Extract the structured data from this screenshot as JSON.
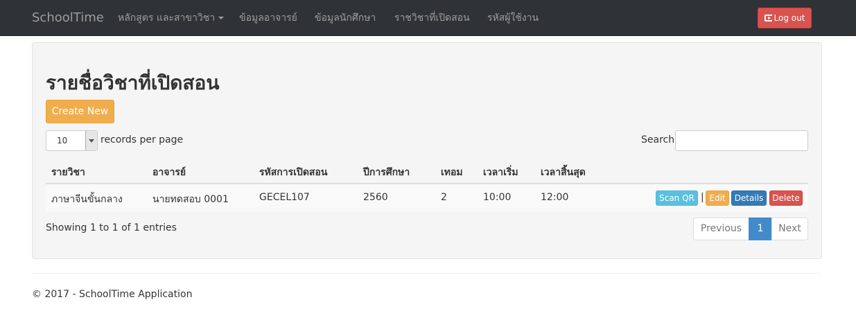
{
  "navbar": {
    "brand": "SchoolTime",
    "items": [
      {
        "label": "หลักสูตร และสาขาวิชา"
      },
      {
        "label": "ข้อมูลอาจารย์"
      },
      {
        "label": "ข้อมูลนักศึกษา"
      },
      {
        "label": "ราชวิชาที่เปิดสอน"
      },
      {
        "label": "รหัสผู้ใช้งาน"
      }
    ],
    "logout_label": "Log out"
  },
  "main": {
    "title": "รายชื่อวิชาที่เปิดสอน",
    "create_label": "Create New",
    "length": {
      "value": "10",
      "label": "records per page"
    },
    "search": {
      "label": "Search:",
      "value": ""
    },
    "table": {
      "headers": [
        "รายวิชา",
        "อาจารย์",
        "รหัสการเปิดสอน",
        "ปีการศึกษา",
        "เทอม",
        "เวลาเริ่ม",
        "เวลาสิ้นสุด"
      ],
      "rows": [
        {
          "cells": [
            "ภาษาจีนขั้นกลาง",
            "นายทดสอบ 0001",
            "GECEL107",
            "2560",
            "2",
            "10:00",
            "12:00"
          ],
          "actions": {
            "scan": "Scan QR",
            "separator": "|",
            "edit": "Edit",
            "details": "Details",
            "delete": "Delete"
          }
        }
      ]
    },
    "info": "Showing 1 to 1 of 1 entries",
    "pagination": {
      "previous": "Previous",
      "current": "1",
      "next": "Next"
    }
  },
  "footer": "© 2017 - SchoolTime Application",
  "colors": {
    "navbar": "#2f3237",
    "danger": "#d9534f",
    "warning": "#f0ad4e",
    "info": "#5bc0de",
    "primary": "#337ab7",
    "page_active": "#428bca"
  },
  "icons": [
    "logout-icon",
    "caret-down-icon",
    "select-arrow-icon"
  ]
}
